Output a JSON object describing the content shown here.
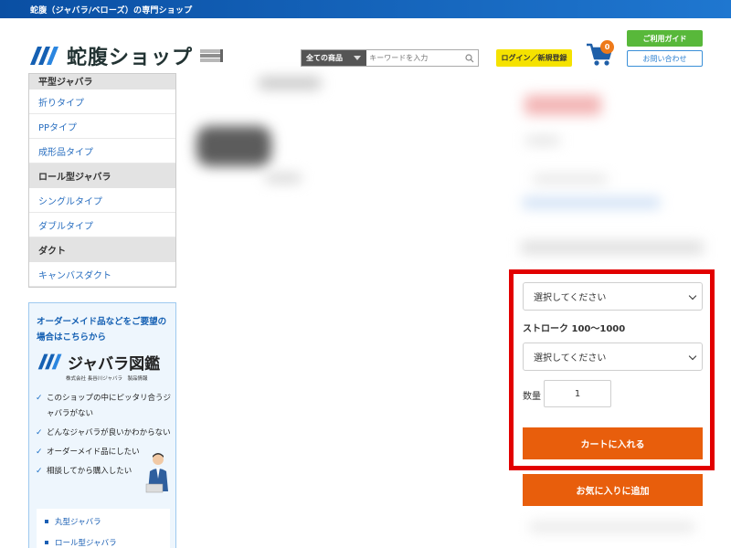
{
  "topbar": {
    "text": "蛇腹（ジャバラ/ベローズ）の専門ショップ"
  },
  "header": {
    "logo_text": "蛇腹ショップ",
    "search": {
      "category": "全ての商品",
      "placeholder": "キーワードを入力"
    },
    "login_label": "ログイン／新規登録",
    "cart_count": "0",
    "guide_label": "ご利用ガイド",
    "contact_label": "お問い合わせ"
  },
  "sidebar": {
    "partial_heading": "平型ジャバラ",
    "items": [
      {
        "type": "item",
        "label": "折りタイプ"
      },
      {
        "type": "item",
        "label": "PPタイプ"
      },
      {
        "type": "item",
        "label": "成形品タイプ"
      },
      {
        "type": "heading",
        "label": "ロール型ジャバラ"
      },
      {
        "type": "item",
        "label": "シングルタイプ"
      },
      {
        "type": "item",
        "label": "ダブルタイプ"
      },
      {
        "type": "heading",
        "label": "ダクト"
      },
      {
        "type": "item",
        "label": "キャンバスダクト"
      }
    ]
  },
  "banner": {
    "title": "オーダーメイド品などをご要望の場合はこちらから",
    "logo_text": "ジャバラ図鑑",
    "company": "株式会社 長谷川ジャバラ　製品情報",
    "checks": [
      "このショップの中にピッタリ合うジャバラがない",
      "どんなジャバラが良いかわからない",
      "オーダーメイド品にしたい",
      "相談してから購入したい"
    ],
    "links": [
      "丸型ジャバラ",
      "ロール型ジャバラ"
    ]
  },
  "purchase": {
    "select1": "選択してください",
    "stroke_label": "ストローク 100〜1000",
    "select2": "選択してください",
    "qty_label": "数量",
    "qty_value": "1",
    "add_to_cart": "カートに入れる",
    "add_to_favorites": "お気に入りに追加"
  },
  "colors": {
    "topbar": "#0a4fa3",
    "orange_button": "#e85e0c",
    "highlight_border": "#e20000",
    "login_button": "#f5e200",
    "guide_button": "#58b83a",
    "link_blue": "#2a6fc0"
  }
}
